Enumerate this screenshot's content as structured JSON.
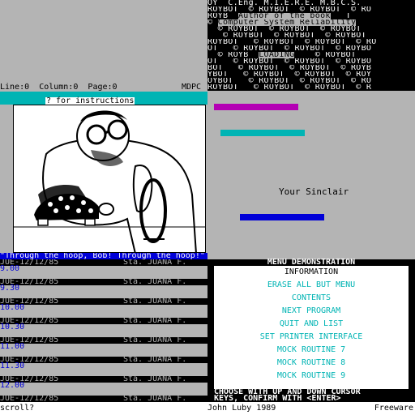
{
  "banner": {
    "lines": [
      "OY  C.Eng. M.I.E.R.E. M.B.C.S.  ",
      "ROYBOT  © ROYBOT  © ROYBOT  © RO",
      "ROYB  Author of the book   T  ",
      "© Computer System Reliability ",
      "  © ROYBOT  © ROYBOT  © ROYBOT  ",
      "   © ROYBOT  © ROYBOT  © ROYBOT ",
      "ROYBOT   © ROYBOT  © ROYBOT  © RO",
      "OT   © ROYBOT  © ROYBOT  © ROYBO",
      "  © ROYB  LOADING    © ROYBOT ",
      "OT   © ROYBOT  © ROYBOT  © ROYBO",
      "BOT   © ROYBOT  © ROYBOT  © ROYB",
      "YBOT   © ROYBOT  © ROYBOT  © ROY",
      "OYBOT   © ROYBOT  © ROYBOT  © RO",
      "ROYBOT   © ROYBOT  © ROYBOT  © R"
    ]
  },
  "status": {
    "line_label": "Line:",
    "line_value": "0",
    "column_label": "Column:",
    "column_value": "0",
    "page_label": "Page:",
    "page_value": "0",
    "mode": "MDPC"
  },
  "instructions": "? for instructions",
  "picture_caption": "\"Through the hoop, Bob! Through the hoop!\"",
  "your_sinclair": "Your Sinclair",
  "colors": {
    "magenta": "#b400b4",
    "cyan": "#00b4b4",
    "blue": "#0000d8",
    "grey": "#b4b4b4"
  },
  "schedule": [
    {
      "date": "JUE-12/12/85",
      "place": "Sta. JUANA F.",
      "time": "9.00"
    },
    {
      "date": "JUE-12/12/85",
      "place": "Sta. JUANA F.",
      "time": "9.30"
    },
    {
      "date": "JUE-12/12/85",
      "place": "Sta. JUANA F.",
      "time": "10.00"
    },
    {
      "date": "JUE-12/12/85",
      "place": "Sta. JUANA F.",
      "time": "10.30"
    },
    {
      "date": "JUE-12/12/85",
      "place": "Sta. JUANA F.",
      "time": "11.00"
    },
    {
      "date": "JUE-12/12/85",
      "place": "Sta. JUANA F.",
      "time": "11.30"
    },
    {
      "date": "JUE-12/12/85",
      "place": "Sta. JUANA F.",
      "time": "12.00"
    },
    {
      "date": "JUE-12/12/85",
      "place": "Sta. JUANA F.",
      "time": ""
    }
  ],
  "menu": {
    "title": "MENU DEMONSTRATION",
    "items": [
      "INFORMATION",
      "ERASE ALL BUT MENU",
      "CONTENTS",
      "NEXT PROGRAM",
      "QUIT AND LIST",
      "SET PRINTER INTERFACE",
      "MOCK ROUTINE 7",
      "MOCK ROUTINE 8",
      "MOCK ROUTINE 9"
    ],
    "selected_index": 0,
    "help_line1": "CHOOSE WITH UP AND DOWN CURSOR",
    "help_line2": "KEYS, CONFIRM WITH <ENTER>"
  },
  "bottom": {
    "prompt": "scroll?",
    "author": "John Luby 1989",
    "license": "Freeware"
  }
}
